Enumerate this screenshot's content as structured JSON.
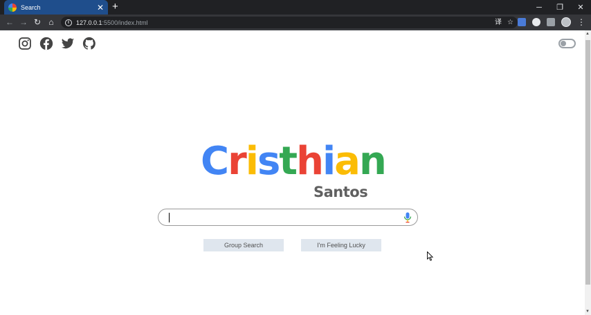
{
  "browser": {
    "tab": {
      "title": "Search"
    },
    "new_tab_label": "+",
    "window": {
      "minimize": "─",
      "restore": "❐",
      "close": "✕"
    },
    "nav": {
      "back": "←",
      "forward": "→",
      "reload": "↻",
      "home": "⌂"
    },
    "url": {
      "host": "127.0.0.1",
      "rest": ":5500/index.html"
    },
    "omnibox_icons": {
      "translate": "译",
      "bookmark": "☆"
    },
    "menu": "⋮"
  },
  "social": [
    {
      "name": "instagram-icon"
    },
    {
      "name": "facebook-icon"
    },
    {
      "name": "twitter-icon"
    },
    {
      "name": "github-icon"
    }
  ],
  "logo": {
    "letters": [
      {
        "ch": "C",
        "color": "#4285f4"
      },
      {
        "ch": "r",
        "color": "#ea4335"
      },
      {
        "ch": "i",
        "color": "#fbbc05"
      },
      {
        "ch": "s",
        "color": "#4285f4"
      },
      {
        "ch": "t",
        "color": "#34a853"
      },
      {
        "ch": "h",
        "color": "#ea4335"
      },
      {
        "ch": "i",
        "color": "#4285f4"
      },
      {
        "ch": "a",
        "color": "#fbbc05"
      },
      {
        "ch": "n",
        "color": "#34a853"
      }
    ],
    "subtitle": "Santos"
  },
  "search": {
    "value": "",
    "placeholder": ""
  },
  "buttons": {
    "search": "Group Search",
    "lucky": "I'm Feeling Lucky"
  },
  "theme_toggle": {
    "on": false
  },
  "colors": {
    "tab_active": "#1f4e8c",
    "chrome_bg": "#202124",
    "button_bg": "#dfe6ee"
  }
}
